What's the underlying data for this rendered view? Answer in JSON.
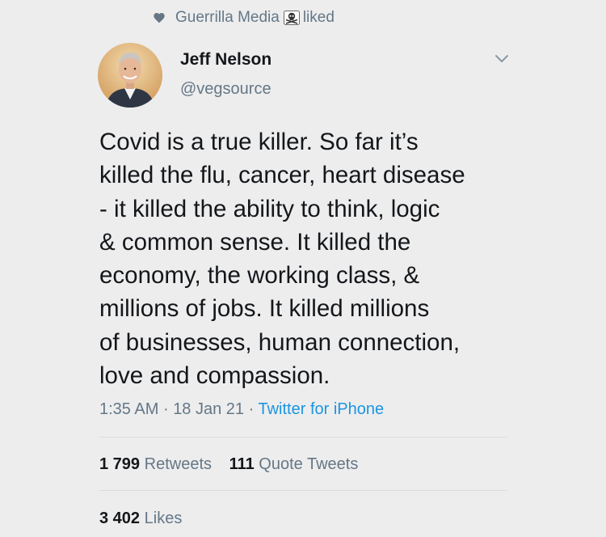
{
  "social_context": {
    "icon": "heart-icon",
    "account": "Guerrilla Media",
    "badge_icon": "skull-crossbones-icon",
    "action": "liked"
  },
  "author": {
    "display_name": "Jeff Nelson",
    "handle": "@vegsource",
    "avatar_icon": "avatar-photo"
  },
  "menu_icon": "chevron-down-icon",
  "tweet": {
    "text": "Covid is a true killer. So far it’s\nkilled the flu, cancer, heart disease\n- it killed the ability to think, logic\n& common sense. It killed the\neconomy, the working class, &\nmillions of jobs. It killed millions\nof businesses, human connection,\nlove and compassion.",
    "time": "1:35 AM",
    "separator": "·",
    "date": "18 Jan 21",
    "source": "Twitter for iPhone"
  },
  "stats": {
    "retweets_count": "1 799",
    "retweets_label": "Retweets",
    "quotes_count": "111",
    "quotes_label": "Quote Tweets",
    "likes_count": "3 402",
    "likes_label": "Likes"
  },
  "colors": {
    "background": "#ededee",
    "secondary_text": "#657786",
    "link": "#1b95e0",
    "primary_text": "#14171a"
  }
}
